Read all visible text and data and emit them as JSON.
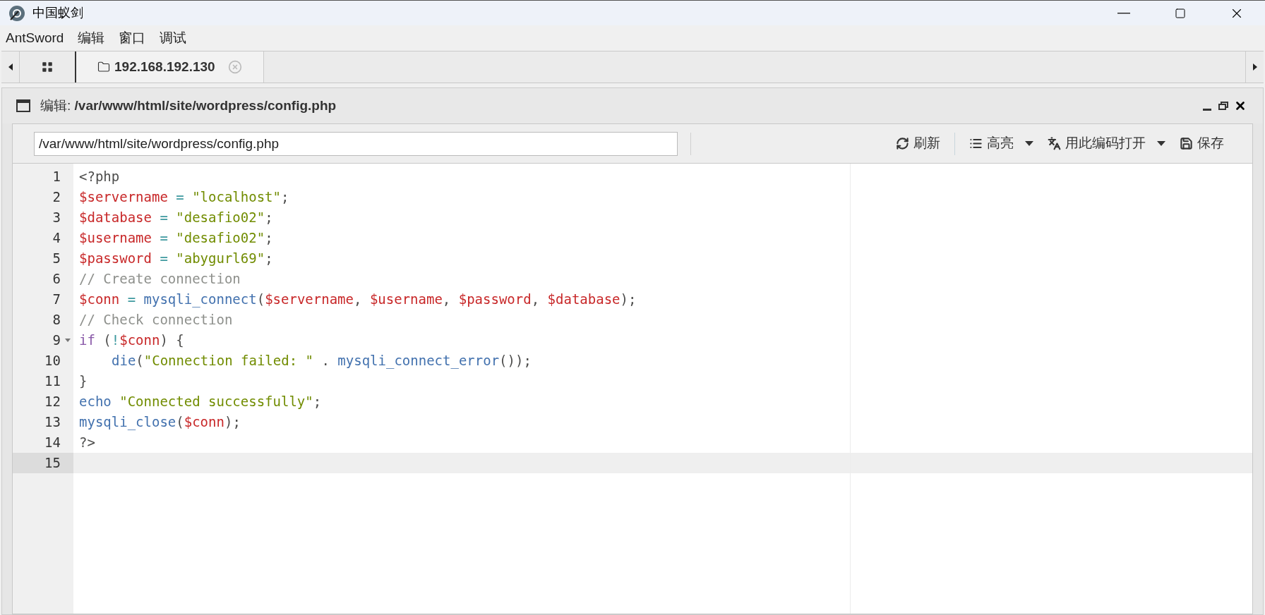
{
  "window": {
    "title": "中国蚁剑"
  },
  "menu": [
    {
      "label": "AntSword"
    },
    {
      "label": "编辑"
    },
    {
      "label": "窗口"
    },
    {
      "label": "调试"
    }
  ],
  "tabs": [
    {
      "kind": "grid",
      "selected": false
    },
    {
      "kind": "folder",
      "label": "192.168.192.130",
      "selected": true
    }
  ],
  "panel": {
    "title_prefix": "编辑:",
    "title_path": "/var/www/html/site/wordpress/config.php"
  },
  "toolbar": {
    "path_value": "/var/www/html/site/wordpress/config.php",
    "buttons": [
      {
        "kind": "refresh",
        "label": "刷新",
        "dropdown": false
      },
      {
        "kind": "list",
        "label": "高亮",
        "dropdown": true
      },
      {
        "kind": "encoding",
        "label": "用此编码打开",
        "dropdown": true
      },
      {
        "kind": "save",
        "label": "保存",
        "dropdown": false
      }
    ]
  },
  "editor": {
    "lines": [
      {
        "number": "1",
        "fold": false,
        "active": false,
        "tokens": [
          {
            "kind": "meta",
            "text": "<?php"
          }
        ]
      },
      {
        "number": "2",
        "fold": false,
        "active": false,
        "tokens": [
          {
            "kind": "var",
            "text": "$servername"
          },
          {
            "kind": "op",
            "text": " = "
          },
          {
            "kind": "str",
            "text": "\"localhost\""
          },
          {
            "kind": "plain",
            "text": ";"
          }
        ]
      },
      {
        "number": "3",
        "fold": false,
        "active": false,
        "tokens": [
          {
            "kind": "var",
            "text": "$database"
          },
          {
            "kind": "op",
            "text": " = "
          },
          {
            "kind": "str",
            "text": "\"desafio02\""
          },
          {
            "kind": "plain",
            "text": ";"
          }
        ]
      },
      {
        "number": "4",
        "fold": false,
        "active": false,
        "tokens": [
          {
            "kind": "var",
            "text": "$username"
          },
          {
            "kind": "op",
            "text": " = "
          },
          {
            "kind": "str",
            "text": "\"desafio02\""
          },
          {
            "kind": "plain",
            "text": ";"
          }
        ]
      },
      {
        "number": "5",
        "fold": false,
        "active": false,
        "tokens": [
          {
            "kind": "var",
            "text": "$password"
          },
          {
            "kind": "op",
            "text": " = "
          },
          {
            "kind": "str",
            "text": "\"abygurl69\""
          },
          {
            "kind": "plain",
            "text": ";"
          }
        ]
      },
      {
        "number": "6",
        "fold": false,
        "active": false,
        "tokens": [
          {
            "kind": "comment",
            "text": "// Create connection"
          }
        ]
      },
      {
        "number": "7",
        "fold": false,
        "active": false,
        "tokens": [
          {
            "kind": "var",
            "text": "$conn"
          },
          {
            "kind": "op",
            "text": " = "
          },
          {
            "kind": "fn",
            "text": "mysqli_connect"
          },
          {
            "kind": "plain",
            "text": "("
          },
          {
            "kind": "var",
            "text": "$servername"
          },
          {
            "kind": "plain",
            "text": ", "
          },
          {
            "kind": "var",
            "text": "$username"
          },
          {
            "kind": "plain",
            "text": ", "
          },
          {
            "kind": "var",
            "text": "$password"
          },
          {
            "kind": "plain",
            "text": ", "
          },
          {
            "kind": "var",
            "text": "$database"
          },
          {
            "kind": "plain",
            "text": ");"
          }
        ]
      },
      {
        "number": "8",
        "fold": false,
        "active": false,
        "tokens": [
          {
            "kind": "comment",
            "text": "// Check connection"
          }
        ]
      },
      {
        "number": "9",
        "fold": true,
        "active": false,
        "tokens": [
          {
            "kind": "kw",
            "text": "if"
          },
          {
            "kind": "plain",
            "text": " ("
          },
          {
            "kind": "op",
            "text": "!"
          },
          {
            "kind": "var",
            "text": "$conn"
          },
          {
            "kind": "plain",
            "text": ") {"
          }
        ],
        "children": [
          {
            "number": "10",
            "fold": false,
            "active": false,
            "tokens": [
              {
                "kind": "fn",
                "text": "die"
              },
              {
                "kind": "plain",
                "text": "("
              },
              {
                "kind": "str",
                "text": "\"Connection failed: \""
              },
              {
                "kind": "plain",
                "text": " . "
              },
              {
                "kind": "fn",
                "text": "mysqli_connect_error"
              },
              {
                "kind": "plain",
                "text": "());"
              }
            ]
          }
        ]
      },
      {
        "number": "11",
        "fold": false,
        "active": false,
        "tokens": [
          {
            "kind": "plain",
            "text": "}"
          }
        ]
      },
      {
        "number": "12",
        "fold": false,
        "active": false,
        "tokens": [
          {
            "kind": "fn",
            "text": "echo"
          },
          {
            "kind": "str",
            "text": " \"Connected successfully\""
          },
          {
            "kind": "plain",
            "text": ";"
          }
        ]
      },
      {
        "number": "13",
        "fold": false,
        "active": false,
        "tokens": [
          {
            "kind": "fn",
            "text": "mysqli_close"
          },
          {
            "kind": "plain",
            "text": "("
          },
          {
            "kind": "var",
            "text": "$conn"
          },
          {
            "kind": "plain",
            "text": ");"
          }
        ]
      },
      {
        "number": "14",
        "fold": false,
        "active": false,
        "tokens": [
          {
            "kind": "meta",
            "text": "?>"
          }
        ]
      },
      {
        "number": "15",
        "fold": false,
        "active": true
      }
    ]
  }
}
